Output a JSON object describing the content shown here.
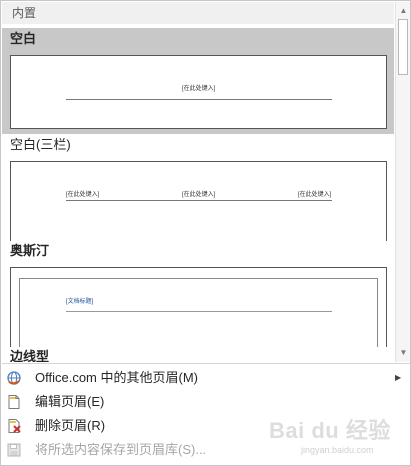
{
  "gallery": {
    "section_header": "内置",
    "items": [
      {
        "title": "空白",
        "placeholders": [
          "[在此处键入]"
        ]
      },
      {
        "title": "空白(三栏)",
        "placeholders": [
          "[在此处键入]",
          "[在此处键入]",
          "[在此处键入]"
        ]
      },
      {
        "title": "奥斯汀",
        "placeholders": [
          "[文档标题]"
        ]
      },
      {
        "title": "边线型"
      }
    ]
  },
  "menu": {
    "more_headers": {
      "label": "Office.com 中的其他页眉(M)",
      "icon": "office-globe-icon"
    },
    "edit_header": {
      "label": "编辑页眉(E)",
      "icon": "edit-page-icon"
    },
    "remove_header": {
      "label": "删除页眉(R)",
      "icon": "remove-page-icon"
    },
    "save_selection": {
      "label": "将所选内容保存到页眉库(S)...",
      "icon": "save-disk-icon",
      "disabled": true
    }
  },
  "watermark": {
    "text": "Bai du 经验",
    "sub": "jingyan.baidu.com"
  }
}
